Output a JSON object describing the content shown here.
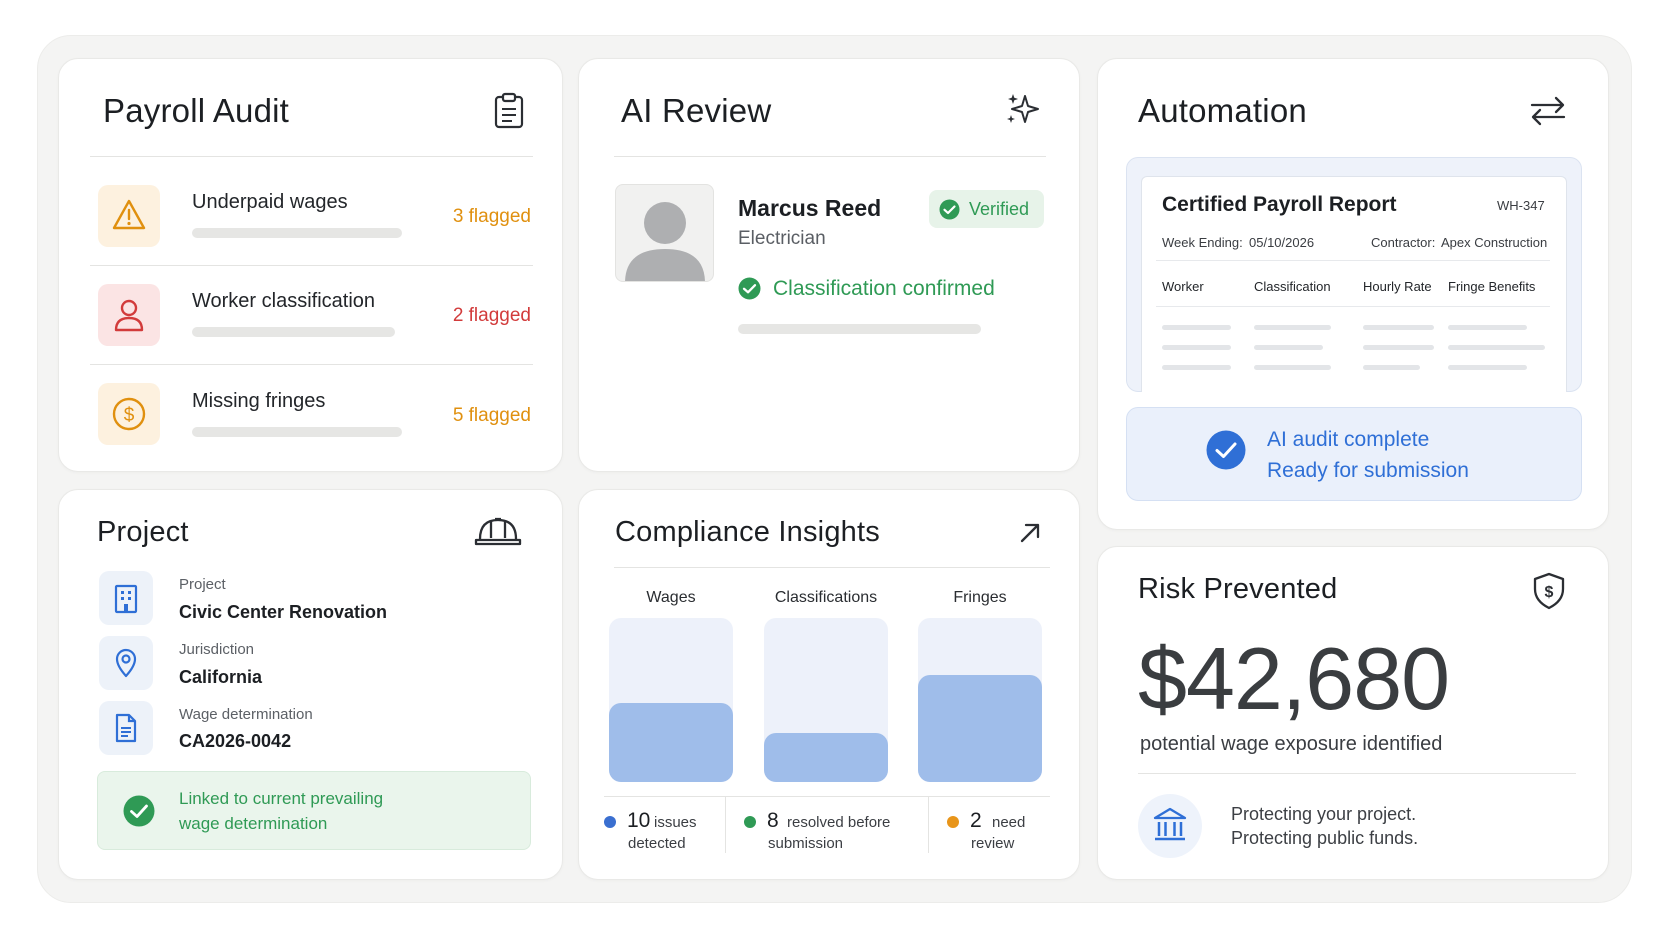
{
  "payroll_audit": {
    "title": "Payroll Audit",
    "icon": "clipboard-icon",
    "rows": [
      {
        "label": "Underpaid wages",
        "flag": "3 flagged",
        "icon": "warning-icon",
        "color": "#e0900f"
      },
      {
        "label": "Worker classification",
        "flag": "2 flagged",
        "icon": "person-icon",
        "color": "#d23b3b"
      },
      {
        "label": "Missing fringes",
        "flag": "5 flagged",
        "icon": "dollar-icon",
        "color": "#e0900f"
      }
    ]
  },
  "ai_review": {
    "title": "AI Review",
    "icon": "sparkle-icon",
    "worker_name": "Marcus Reed",
    "worker_role": "Electrician",
    "badge": "Verified",
    "status": "Classification confirmed"
  },
  "automation": {
    "title": "Automation",
    "icon": "swap-arrows-icon",
    "report": {
      "title": "Certified Payroll Report",
      "form_id": "WH-347",
      "week_label": "Week Ending:",
      "week_value": "05/10/2026",
      "contractor_label": "Contractor:",
      "contractor_value": "Apex Construction",
      "columns": [
        "Worker",
        "Classification",
        "Hourly Rate",
        "Fringe Benefits"
      ]
    },
    "status_title": "AI audit complete",
    "status_sub": "Ready for submission"
  },
  "project": {
    "title": "Project",
    "icon": "hardhat-icon",
    "fields": [
      {
        "key": "Project",
        "value": "Civic Center Renovation",
        "icon": "building-icon"
      },
      {
        "key": "Jurisdiction",
        "value": "California",
        "icon": "location-pin-icon"
      },
      {
        "key": "Wage determination",
        "value": "CA2026-0042",
        "icon": "document-icon"
      }
    ],
    "linked_line1": "Linked to current prevailing",
    "linked_line2": "wage determination"
  },
  "compliance": {
    "title": "Compliance Insights",
    "icon": "arrow-up-right-icon",
    "stats": [
      {
        "num": "10",
        "text1": "issues",
        "text2": "detected",
        "color": "#3a6fd0"
      },
      {
        "num": "8",
        "text1": "resolved before",
        "text2": "submission",
        "color": "#2f9a55"
      },
      {
        "num": "2",
        "text1": "need",
        "text2": "review",
        "color": "#e8951a"
      }
    ]
  },
  "chart_data": {
    "type": "bar",
    "categories": [
      "Wages",
      "Classifications",
      "Fringes"
    ],
    "values": [
      0.48,
      0.3,
      0.65
    ],
    "ylim": [
      0,
      1
    ],
    "grid": false,
    "legend": "none"
  },
  "risk": {
    "title": "Risk Prevented",
    "icon": "shield-dollar-icon",
    "amount": "$42,680",
    "subtitle": "potential wage exposure identified",
    "line1": "Protecting your project.",
    "line2": "Protecting public funds.",
    "bottom_icon": "bank-icon"
  },
  "colors": {
    "accent_blue": "#2f6fd6",
    "success_green": "#2f9a55",
    "warning_orange": "#e0900f",
    "danger_red": "#d23b3b",
    "bar_fill": "#9fbdea"
  }
}
